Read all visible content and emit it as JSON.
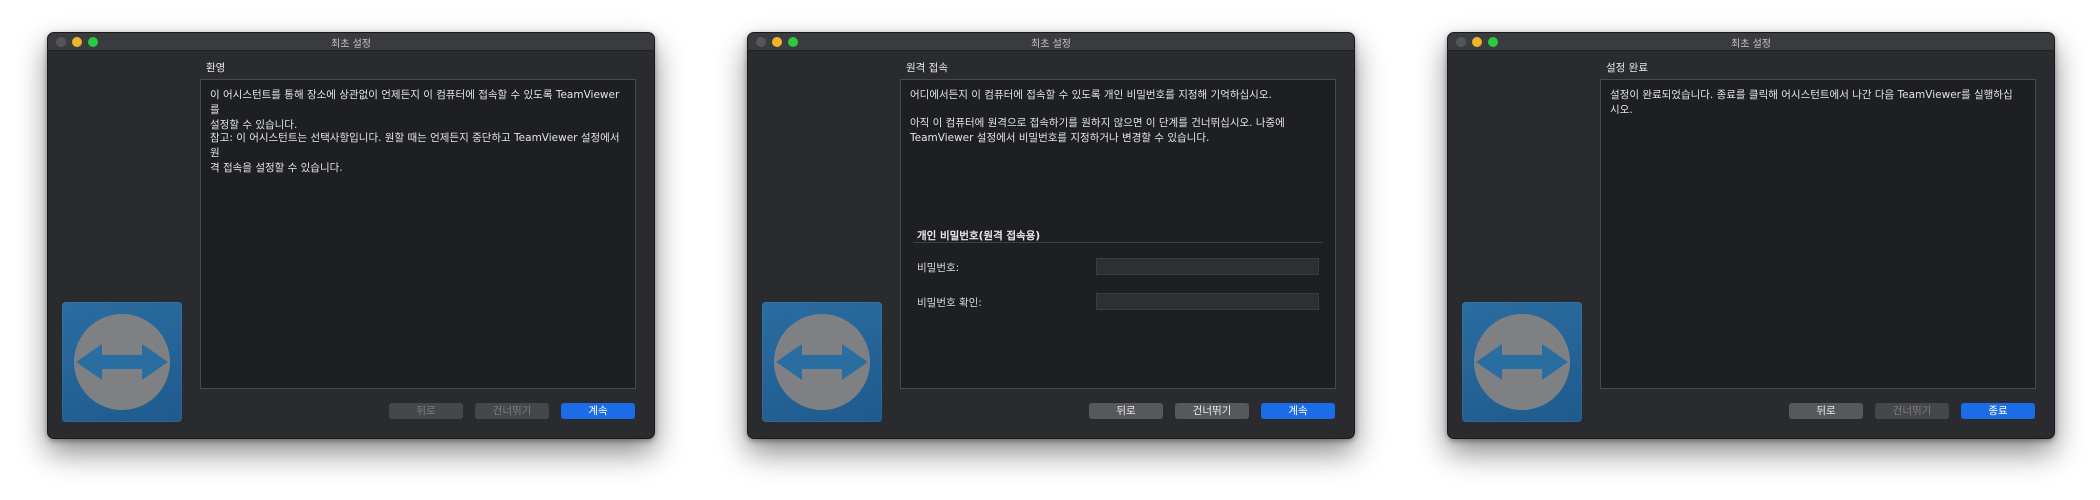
{
  "windows": [
    {
      "title": "최초 설정",
      "heading": "환영",
      "paragraphs": [
        "이 어시스턴트를 통해 장소에 상관없이 언제든지 이 컴퓨터에 접속할 수 있도록 TeamViewer를\n설정할 수 있습니다.",
        "참고: 이 어시스턴트는 선택사항입니다. 원할 때는 언제든지 중단하고 TeamViewer 설정에서 원\n격 접속을 설정할 수 있습니다."
      ],
      "buttons": {
        "back": "뒤로",
        "skip": "건너뛰기",
        "next": "계속"
      }
    },
    {
      "title": "최초 설정",
      "heading": "원격 접속",
      "paragraphs": [
        "어디에서든지 이 컴퓨터에 접속할 수 있도록 개인 비밀번호를 지정해 기억하십시오.",
        "아직 이 컴퓨터에 원격으로 접속하기를 원하지 않으면 이 단계를 건너뛰십시오. 나중에\nTeamViewer 설정에서 비밀번호를 지정하거나 변경할 수 있습니다."
      ],
      "section_title": "개인 비밀번호(원격 접속용)",
      "password_label": "비밀번호:",
      "password_value": "",
      "confirm_label": "비밀번호 확인:",
      "confirm_value": "",
      "buttons": {
        "back": "뒤로",
        "skip": "건너뛰기",
        "next": "계속"
      }
    },
    {
      "title": "최초 설정",
      "heading": "설정 완료",
      "paragraphs": [
        "설정이 완료되었습니다. 종료를 클릭해 어시스턴트에서 나간 다음 TeamViewer를 실행하십시오."
      ],
      "buttons": {
        "back": "뒤로",
        "skip": "건너뛰기",
        "finish": "종료"
      }
    }
  ],
  "colors": {
    "window_bg": "#2a2b2f",
    "content_bg": "#1e1f23",
    "primary_button": "#1b6ce6",
    "logo_blue": "#2a6da1"
  },
  "icons": {
    "logo": "teamviewer-logo-icon"
  }
}
